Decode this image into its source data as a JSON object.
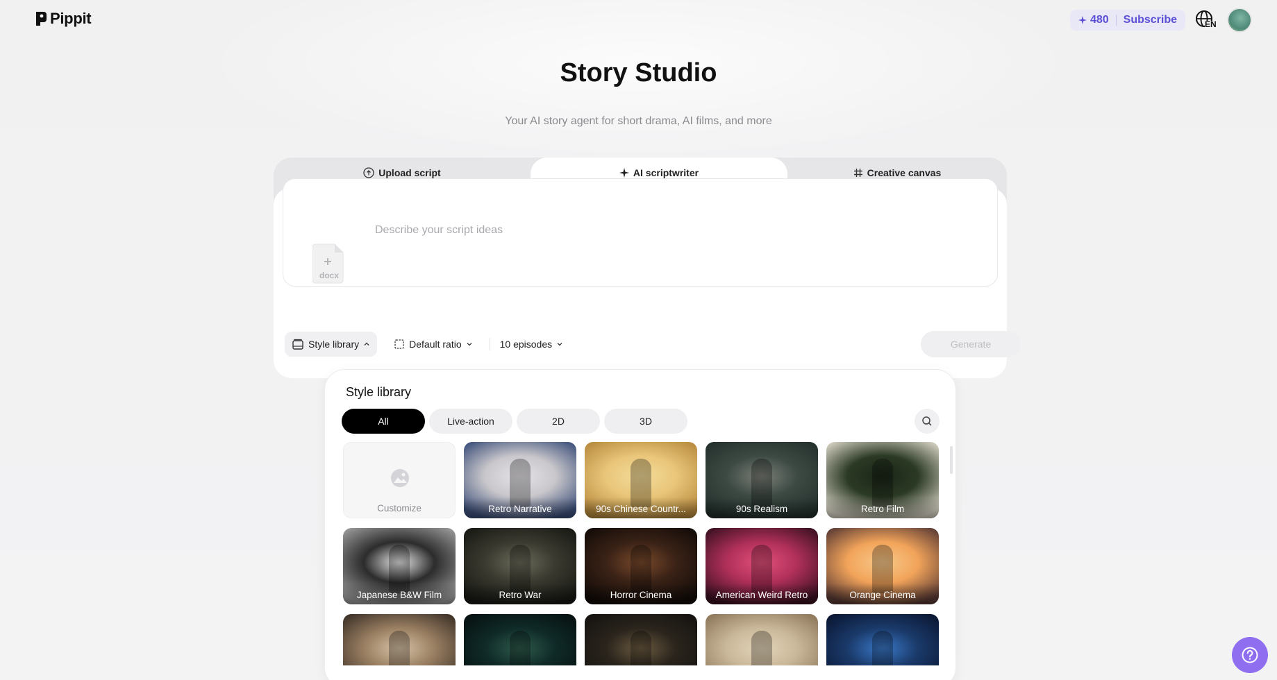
{
  "header": {
    "brand": "Pippit",
    "credits": "480",
    "subscribe_label": "Subscribe",
    "language": "EN"
  },
  "hero": {
    "title": "Story Studio",
    "subtitle": "Your AI story agent for short drama, AI films, and more"
  },
  "tabs": [
    {
      "label": "Upload script",
      "icon": "upload-circle-icon",
      "active": false
    },
    {
      "label": "AI scriptwriter",
      "icon": "sparkle-icon",
      "active": true
    },
    {
      "label": "Creative canvas",
      "icon": "hash-grid-icon",
      "active": false
    }
  ],
  "composer": {
    "placeholder": "Describe your script ideas",
    "attach_label": "docx",
    "controls": {
      "style_library": "Style library",
      "ratio": "Default ratio",
      "episodes": "10 episodes"
    },
    "generate_label": "Generate"
  },
  "style_library": {
    "title": "Style library",
    "filters": [
      "All",
      "Live-action",
      "2D",
      "3D"
    ],
    "selected_filter": "All",
    "items": [
      {
        "label": "Customize",
        "kind": "custom"
      },
      {
        "label": "Retro Narrative",
        "palette": [
          "#c9c7cb",
          "#3c4f7a",
          "#e5e3e7"
        ]
      },
      {
        "label": "90s Chinese Countr...",
        "palette": [
          "#e9c67a",
          "#b78a3e",
          "#f4dc9a"
        ]
      },
      {
        "label": "90s Realism",
        "palette": [
          "#3d4a44",
          "#23302b",
          "#7c7f78"
        ]
      },
      {
        "label": "Retro Film",
        "palette": [
          "#2b3a24",
          "#d9d4c6",
          "#1a2418"
        ]
      },
      {
        "label": "Japanese B&W Film",
        "palette": [
          "#2c2c2c",
          "#9b9b9b",
          "#e8e8e8"
        ]
      },
      {
        "label": "Retro War",
        "palette": [
          "#3a3a30",
          "#181814",
          "#6b6a5a"
        ]
      },
      {
        "label": "Horror Cinema",
        "palette": [
          "#3a2216",
          "#120b08",
          "#7a4a2c"
        ]
      },
      {
        "label": "American Weird Retro",
        "palette": [
          "#b0305a",
          "#3a1020",
          "#e2507a"
        ]
      },
      {
        "label": "Orange Cinema",
        "palette": [
          "#f2a45a",
          "#5a3a34",
          "#f7c98a"
        ]
      },
      {
        "label": "",
        "palette": [
          "#9a7f62",
          "#3a2f26",
          "#d6c2a6"
        ]
      },
      {
        "label": "",
        "palette": [
          "#0f2a28",
          "#06100f",
          "#2e5a4a"
        ]
      },
      {
        "label": "",
        "palette": [
          "#2a241c",
          "#141210",
          "#6b5a40"
        ]
      },
      {
        "label": "",
        "palette": [
          "#cab89a",
          "#8c7558",
          "#e3d4b8"
        ]
      },
      {
        "label": "",
        "palette": [
          "#1a3a6a",
          "#0a1530",
          "#3a78c8"
        ]
      }
    ]
  },
  "help_icon": "question-circle-icon"
}
